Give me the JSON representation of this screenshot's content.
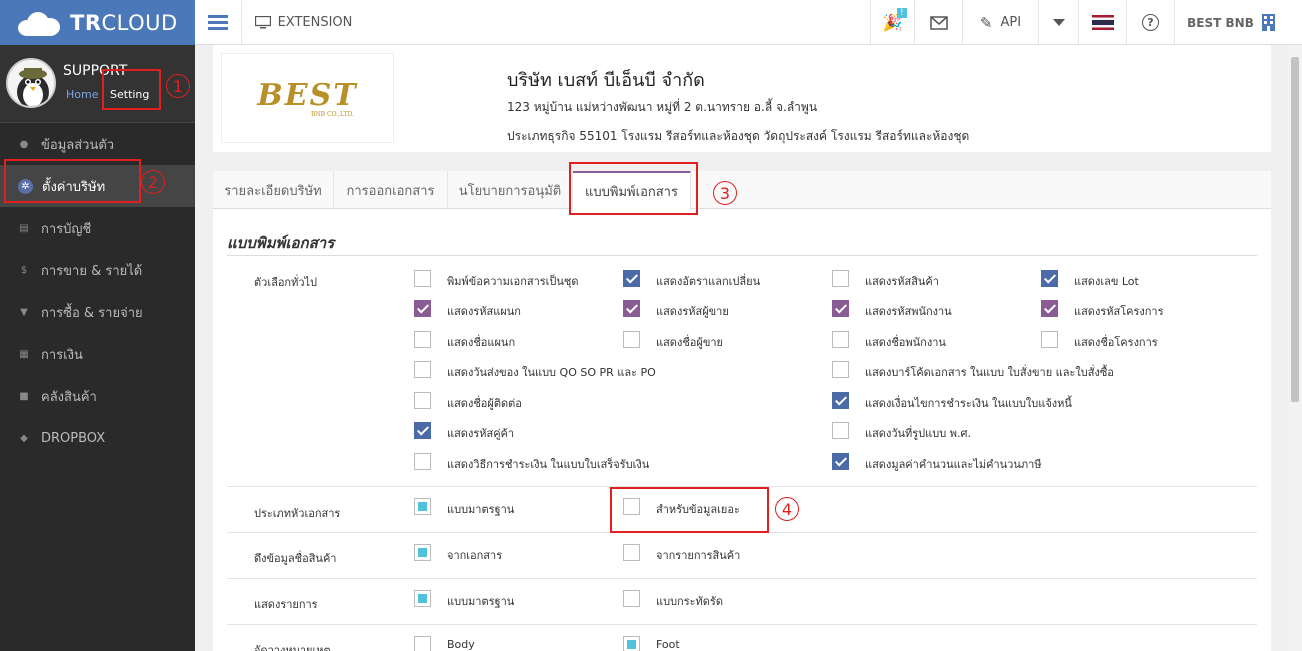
{
  "app": {
    "logo_text_bold": "TR",
    "logo_text_light": "CLOUD"
  },
  "profile": {
    "name": "SUPPORT",
    "home_link": "Home",
    "setting_link": "Setting"
  },
  "sidebar": {
    "items": [
      {
        "label": "ข้อมูลส่วนตัว",
        "icon": "user-icon"
      },
      {
        "label": "ตั้งค่าบริษัท",
        "icon": "gear-icon",
        "active": true
      },
      {
        "label": "การบัญชี",
        "icon": "book-icon"
      },
      {
        "label": "การขาย & รายได้",
        "icon": "dollar-icon"
      },
      {
        "label": "การซื้อ & รายจ่าย",
        "icon": "cart-icon"
      },
      {
        "label": "การเงิน",
        "icon": "calendar-icon"
      },
      {
        "label": "คลังสินค้า",
        "icon": "truck-icon"
      },
      {
        "label": "DROPBOX",
        "icon": "dropbox-icon"
      }
    ]
  },
  "topbar": {
    "extension_label": "EXTENSION",
    "notification_badge": "!",
    "api_label": "API",
    "company_short": "BEST BNB"
  },
  "company": {
    "logo_text": "BEST",
    "logo_sub": "BNB CO.,LTD.",
    "name": "บริษัท เบสท์ บีเอ็นบี จำกัด",
    "address": "123 หมู่บ้าน แม่หว่างพัฒนา หมู่ที่ 2 ต.นาทราย อ.ลี้ จ.ลำพูน",
    "business_type": "ประเภทธุรกิจ 55101 โรงแรม รีสอร์ทและห้องชุด วัดถุประสงค์ โรงแรม รีสอร์ทและห้องชุด"
  },
  "tabs": [
    {
      "label": "รายละเอียดบริษัท"
    },
    {
      "label": "การออกเอกสาร"
    },
    {
      "label": "นโยบายการอนุมัติ"
    },
    {
      "label": "แบบพิมพ์เอกสาร",
      "active": true
    }
  ],
  "section": {
    "title": "แบบพิมพ์เอกสาร",
    "general_label": "ตัวเลือกทั่วไป",
    "header_label": "ประเภทหัวเอกสาร",
    "product_name_label": "ดึงข้อมูลชื่อสินค้า",
    "display_items_label": "แสดงรายการ",
    "notes_label": "จัดวางหมายเหตุ"
  },
  "options": {
    "o1": "พิมพ์ข้อความเอกสารเป็นชุด",
    "o2": "แสดงอัตราแลกเปลี่ยน",
    "o3": "แสดงรหัสสินค้า",
    "o4": "แสดงเลข Lot",
    "o5": "แสดงรหัสแผนก",
    "o6": "แสดงรหัสผู้ขาย",
    "o7": "แสดงรหัสพนักงาน",
    "o8": "แสดงรหัสโครงการ",
    "o9": "แสดงชื่อแผนก",
    "o10": "แสดงชื่อผู้ขาย",
    "o11": "แสดงชื่อพนักงาน",
    "o12": "แสดงชื่อโครงการ",
    "o13": "แสดงวันส่งของ ในแบบ QO SO PR และ PO",
    "o14": "แสดงบาร์โค้ดเอกสาร ในแบบ ใบสั่งขาย และใบสั่งซื้อ",
    "o15": "แสดงชื่อผู้ติดต่อ",
    "o16": "แสดงเงื่อนไขการชำระเงิน ในแบบใบแจ้งหนี้",
    "o17": "แสดงรหัสคู่ค้า",
    "o18": "แสดงวันที่รูปแบบ พ.ศ.",
    "o19": "แสดงวิธีการชำระเงิน ในแบบใบเสร็จรับเงิน",
    "o20": "แสดงมูลค่าคำนวนและไม่คำนวนภาษี"
  },
  "header_type": {
    "standard": "แบบมาตรฐาน",
    "large_data": "สำหรับข้อมูลเยอะ"
  },
  "product_name": {
    "from_doc": "จากเอกสาร",
    "from_list": "จากรายการสินค้า"
  },
  "display_items": {
    "standard": "แบบมาตรฐาน",
    "compact": "แบบกระทัดรัด"
  },
  "notes_position": {
    "body": "Body",
    "foot": "Foot"
  },
  "annotations": {
    "n1": "1",
    "n2": "2",
    "n3": "3",
    "n4": "4"
  }
}
